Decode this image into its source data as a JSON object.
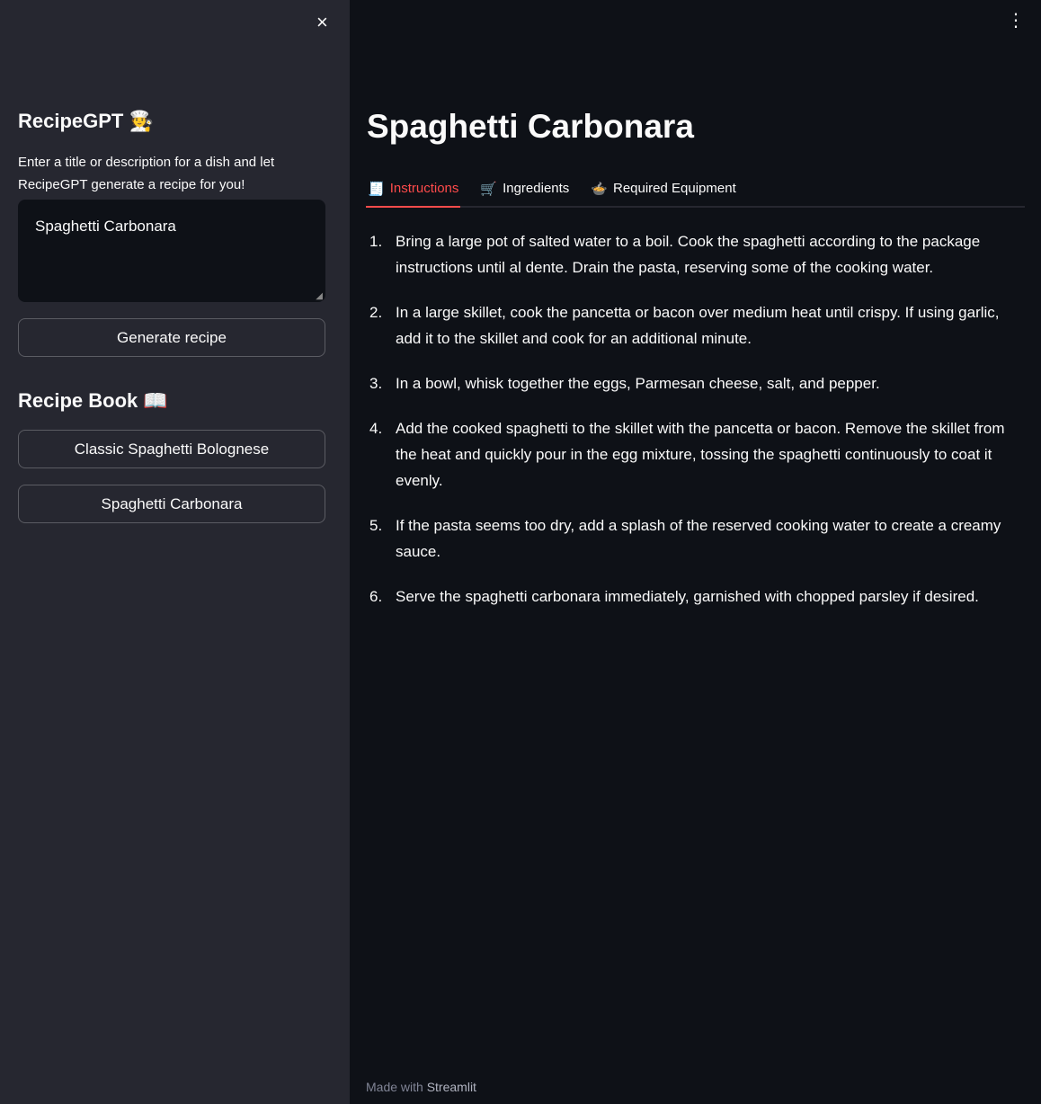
{
  "sidebar": {
    "close_icon": "×",
    "title": "RecipeGPT",
    "title_emoji": "🧑‍🍳",
    "description": "Enter a title or description for a dish and let RecipeGPT generate a recipe for you!",
    "input_value": "Spaghetti Carbonara",
    "generate_label": "Generate recipe",
    "book_title": "Recipe Book",
    "book_emoji": "📖",
    "book_items": [
      "Classic Spaghetti Bolognese",
      "Spaghetti Carbonara"
    ]
  },
  "main": {
    "menu_icon": "⋮",
    "title": "Spaghetti Carbonara",
    "tabs": [
      {
        "icon": "🧾",
        "label": "Instructions"
      },
      {
        "icon": "🛒",
        "label": "Ingredients"
      },
      {
        "icon": "🍲",
        "label": "Required Equipment"
      }
    ],
    "steps": [
      {
        "n": "1.",
        "text": "Bring a large pot of salted water to a boil. Cook the spaghetti according to the package instructions until al dente. Drain the pasta, reserving some of the cooking water."
      },
      {
        "n": "2.",
        "text": "In a large skillet, cook the pancetta or bacon over medium heat until crispy. If using garlic, add it to the skillet and cook for an additional minute."
      },
      {
        "n": "3.",
        "text": "In a bowl, whisk together the eggs, Parmesan cheese, salt, and pepper."
      },
      {
        "n": "4.",
        "text": "Add the cooked spaghetti to the skillet with the pancetta or bacon. Remove the skillet from the heat and quickly pour in the egg mixture, tossing the spaghetti continuously to coat it evenly."
      },
      {
        "n": "5.",
        "text": "If the pasta seems too dry, add a splash of the reserved cooking water to create a creamy sauce."
      },
      {
        "n": "6.",
        "text": "Serve the spaghetti carbonara immediately, garnished with chopped parsley if desired."
      }
    ],
    "footer_prefix": "Made with",
    "footer_brand": "Streamlit"
  },
  "colors": {
    "sidebar": "#262730",
    "background": "#0e1117",
    "accent": "#ff4b4b"
  }
}
